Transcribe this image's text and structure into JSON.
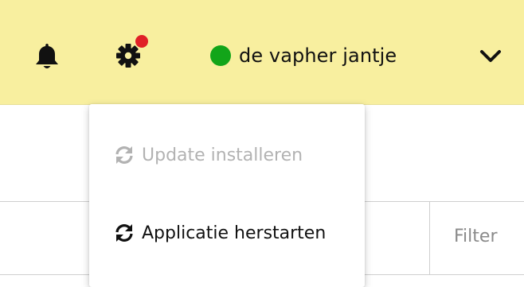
{
  "topbar": {
    "background": "#f8ef9f",
    "icons": {
      "bell": "bell-icon",
      "settings": "gear-icon",
      "menu": "chevron-down-icon"
    },
    "notification_dot_color": "#e02027",
    "user": {
      "name": "de vapher jantje",
      "status_color": "#12a519"
    }
  },
  "dropdown": {
    "items": [
      {
        "label": "Update installeren",
        "icon": "refresh-icon",
        "disabled": true
      },
      {
        "label": "Applicatie herstarten",
        "icon": "refresh-icon",
        "disabled": false
      }
    ]
  },
  "table": {
    "filter_placeholder": "Filter"
  }
}
